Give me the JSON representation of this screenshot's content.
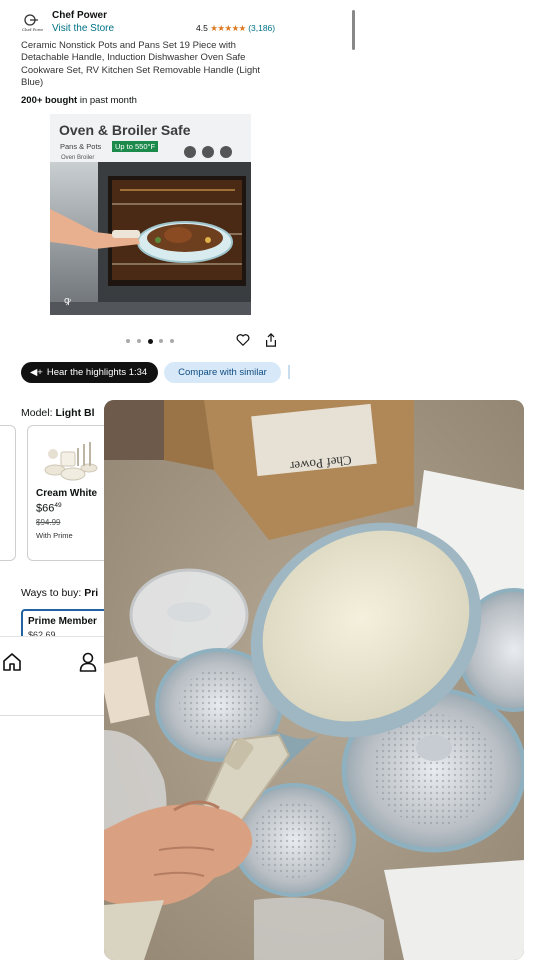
{
  "product": {
    "brand": "Chef Power",
    "store_link": "Visit the Store",
    "rating_value": "4.5",
    "rating_stars": "★★★★★",
    "rating_count": "(3,186)",
    "title": "Ceramic Nonstick Pots and Pans Set 19 Piece with Detachable Handle, Induction Dishwasher Oven Safe Cookware Set, RV Kitchen Set Removable Handle (Light Blue)",
    "bought_bold": "200+ bought",
    "bought_rest": " in past month"
  },
  "hero": {
    "headline": "Oven & Broiler Safe",
    "sub": "Pans & Pots",
    "badge": "Up to 550°F",
    "icon_captions": "Oven  Broiler",
    "carousel_count": 5,
    "carousel_active": 3
  },
  "actions": {
    "highlights": "Hear the highlights 1:34",
    "compare": "Compare with similar"
  },
  "model": {
    "label": "Model: ",
    "selected": "Light Bl"
  },
  "variant": {
    "name": "Cream White",
    "price_dollars": "$66",
    "price_cents": "49",
    "list_price": "$94.99",
    "note": "With Prime"
  },
  "ways_to_buy": {
    "label": "Ways to buy: ",
    "selected": "Pri",
    "option_title": "Prime Member",
    "option_price": "$62.69"
  },
  "nav": {
    "icons": [
      "home-icon",
      "account-icon"
    ]
  },
  "overlay": {
    "box_brand": "Chef Power"
  },
  "colors": {
    "link": "#007185",
    "star": "#de7921",
    "badge_green": "#1c8a4b",
    "compare_bg": "#d7e9f8",
    "prime_border": "#2162a1"
  }
}
